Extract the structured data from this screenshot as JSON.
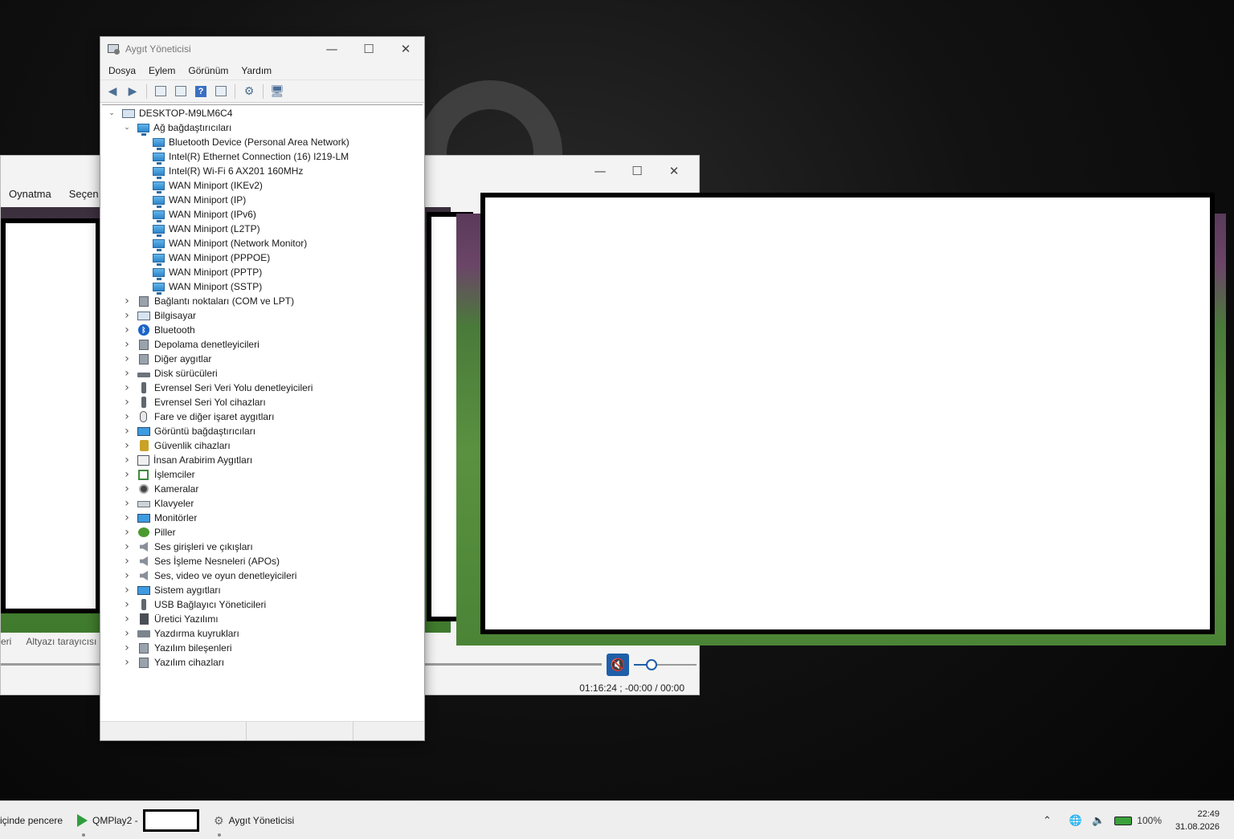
{
  "desktop": {
    "background_color": "#0b0b0b"
  },
  "player": {
    "menu": [
      "Oynatma",
      "Seçen"
    ],
    "bottom_tabs": [
      "eri",
      "Altyazı tarayıcısı"
    ],
    "window_buttons": [
      "—",
      "☐",
      "✕"
    ],
    "timecode": "01:16:24 ; -00:00 / 00:00",
    "volume_icon": "muted-speaker-icon",
    "volume_level": 0.23,
    "accent_color": "#1e5fa8"
  },
  "devmgr": {
    "title": "Aygıt Yöneticisi",
    "window_buttons": [
      "—",
      "☐",
      "✕"
    ],
    "menu": [
      "Dosya",
      "Eylem",
      "Görünüm",
      "Yardım"
    ],
    "toolbar": [
      "back-arrow-icon",
      "forward-arrow-icon",
      "properties-icon",
      "list-icon",
      "help-icon",
      "update-driver-icon",
      "scan-hardware-icon",
      "monitor-icon"
    ],
    "root": "DESKTOP-M9LM6C4",
    "network_group": "Ağ bağdaştırıcıları",
    "network_items": [
      "Bluetooth Device (Personal Area Network)",
      "Intel(R) Ethernet Connection (16) I219-LM",
      "Intel(R) Wi-Fi 6 AX201 160MHz",
      "WAN Miniport (IKEv2)",
      "WAN Miniport (IP)",
      "WAN Miniport (IPv6)",
      "WAN Miniport (L2TP)",
      "WAN Miniport (Network Monitor)",
      "WAN Miniport (PPPOE)",
      "WAN Miniport (PPTP)",
      "WAN Miniport (SSTP)"
    ],
    "categories": [
      "Bağlantı noktaları (COM ve LPT)",
      "Bilgisayar",
      "Bluetooth",
      "Depolama denetleyicileri",
      "Diğer aygıtlar",
      "Disk sürücüleri",
      "Evrensel Seri Veri Yolu denetleyicileri",
      "Evrensel Seri Yol cihazları",
      "Fare ve diğer işaret aygıtları",
      "Görüntü bağdaştırıcıları",
      "Güvenlik cihazları",
      "İnsan Arabirim Aygıtları",
      "İşlemciler",
      "Kameralar",
      "Klavyeler",
      "Monitörler",
      "Piller",
      "Ses girişleri ve çıkışları",
      "Ses İşleme Nesneleri (APOs)",
      "Ses, video ve oyun denetleyicileri",
      "Sistem aygıtları",
      "USB Bağlayıcı Yöneticileri",
      "Üretici Yazılımı",
      "Yazdırma kuyrukları",
      "Yazılım bileşenleri",
      "Yazılım cihazları"
    ]
  },
  "taskbar": {
    "items": [
      "içinde pencere",
      "QMPlay2 -",
      "Aygıt Yöneticisi"
    ],
    "battery": "100%",
    "time": "22:49",
    "date": "31.08.2026"
  }
}
